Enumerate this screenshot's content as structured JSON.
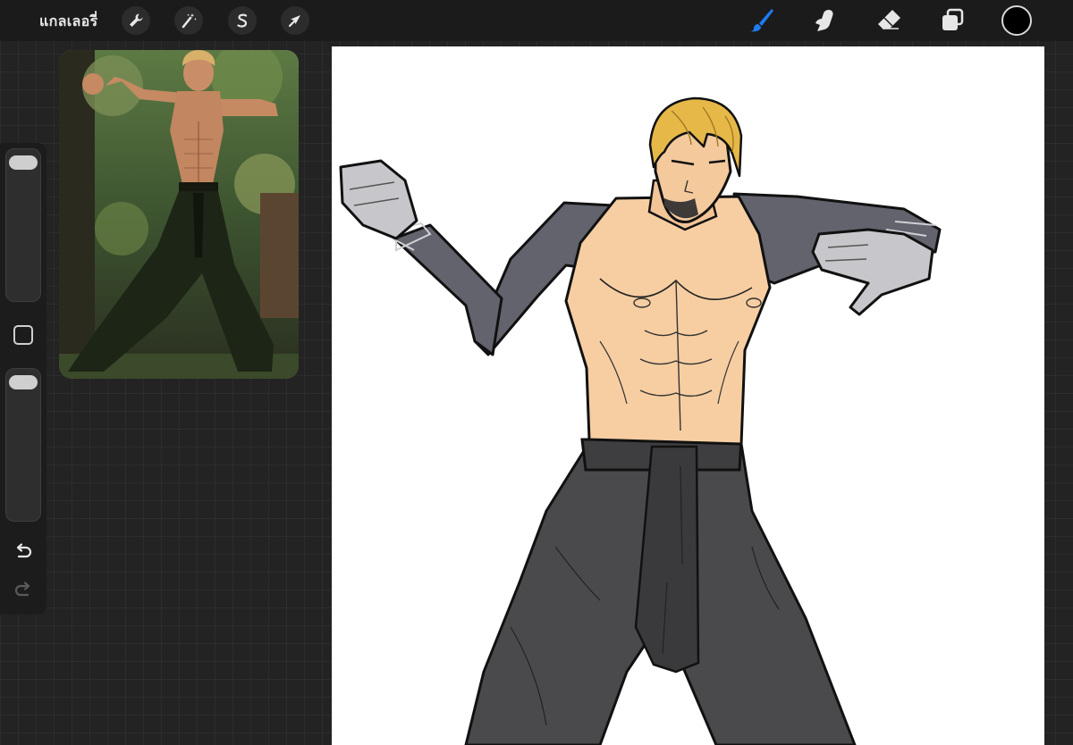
{
  "toolbar": {
    "gallery_label": "แกลเลอรี่",
    "actions_icon": "wrench-icon",
    "adjustments_icon": "magic-wand-icon",
    "selection_icon": "selection-s-icon",
    "transform_icon": "arrow-cursor-icon"
  },
  "tools": {
    "brush_icon": "brush-icon",
    "smudge_icon": "smudge-finger-icon",
    "eraser_icon": "eraser-icon",
    "layers_icon": "layers-icon",
    "active_tool": "brush",
    "active_color": "#000000",
    "accent_color": "#1e7bf0"
  },
  "sidebar": {
    "brush_size": 0.02,
    "opacity": 0.02
  },
  "reference": {
    "icon": "reference-photo"
  },
  "colors": {
    "skin": "#f7cea2",
    "suit": "#62636c",
    "gloves": "#c7c7cb",
    "pants": "#4a4a4c",
    "hair": "#e6b848"
  }
}
